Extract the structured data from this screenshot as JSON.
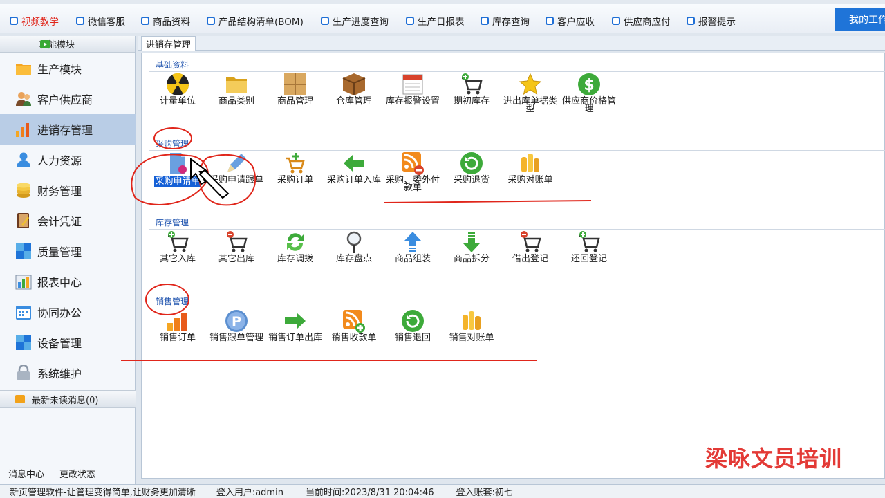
{
  "toolbar": {
    "items": [
      "视频教学",
      "微信客服",
      "商品资料",
      "产品结构清单(BOM)",
      "生产进度查询",
      "生产日报表",
      "库存查询",
      "客户应收",
      "供应商应付",
      "报警提示"
    ],
    "work_button": "我的工作"
  },
  "sidebar": {
    "header": "功能模块",
    "items": [
      "生产模块",
      "客户供应商",
      "进销存管理",
      "人力资源",
      "财务管理",
      "会计凭证",
      "质量管理",
      "报表中心",
      "协同办公",
      "设备管理",
      "系统维护"
    ],
    "messages": "最新未读消息(0)",
    "footer": [
      "消息中心",
      "更改状态"
    ]
  },
  "tab": {
    "label": "进销存管理"
  },
  "sections": [
    {
      "title": "基础资料",
      "items": [
        "计量单位",
        "商品类别",
        "商品管理",
        "仓库管理",
        "库存报警设置",
        "期初库存",
        "进出库单据类型",
        "供应商价格管理"
      ]
    },
    {
      "title": "采购管理",
      "items": [
        "采购申请单",
        "采购申请跟单",
        "采购订单",
        "采购订单入库",
        "采购、委外付款单",
        "采购退货",
        "采购对账单"
      ]
    },
    {
      "title": "库存管理",
      "items": [
        "其它入库",
        "其它出库",
        "库存调拨",
        "库存盘点",
        "商品组装",
        "商品拆分",
        "借出登记",
        "还回登记"
      ]
    },
    {
      "title": "销售管理",
      "items": [
        "销售订单",
        "销售跟单管理",
        "销售订单出库",
        "销售收款单",
        "销售退回",
        "销售对账单"
      ]
    }
  ],
  "watermark": "梁咏文员培训",
  "status": {
    "slogan": "新页管理软件-让管理变得简单,让财务更加清晰",
    "user": "登入用户:admin",
    "time": "当前时间:2023/8/31 20:04:46",
    "account": "登入账套:初七"
  },
  "colors": {
    "accent": "#1f74d8",
    "selected_menu": "#b9cde6",
    "annotation": "#e0261b",
    "watermark": "#e33a36"
  }
}
